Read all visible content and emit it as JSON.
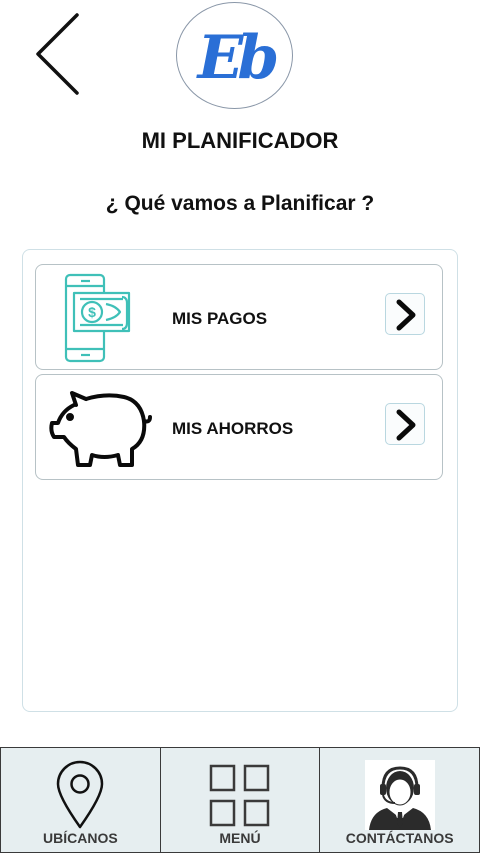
{
  "header": {
    "back_icon": "chevron-left-icon",
    "logo_text": "Eb",
    "logo_color": "#2a6fd6",
    "title": "MI PLANIFICADOR",
    "subtitle": "¿ Qué vamos a Planificar ?"
  },
  "options": [
    {
      "label": "MIS PAGOS",
      "icon": "mobile-payment-icon",
      "icon_color": "#3fc0b8",
      "action_icon": "chevron-right-icon"
    },
    {
      "label": "MIS AHORROS",
      "icon": "piggy-bank-icon",
      "action_icon": "chevron-right-icon"
    }
  ],
  "bottom_nav": [
    {
      "label": "UBÍCANOS",
      "icon": "location-pin-icon"
    },
    {
      "label": "MENÚ",
      "icon": "grid-menu-icon"
    },
    {
      "label": "CONTÁCTANOS",
      "icon": "support-agent-icon"
    }
  ],
  "colors": {
    "nav_background": "#e6eef0",
    "panel_border": "#cfe0e6"
  }
}
